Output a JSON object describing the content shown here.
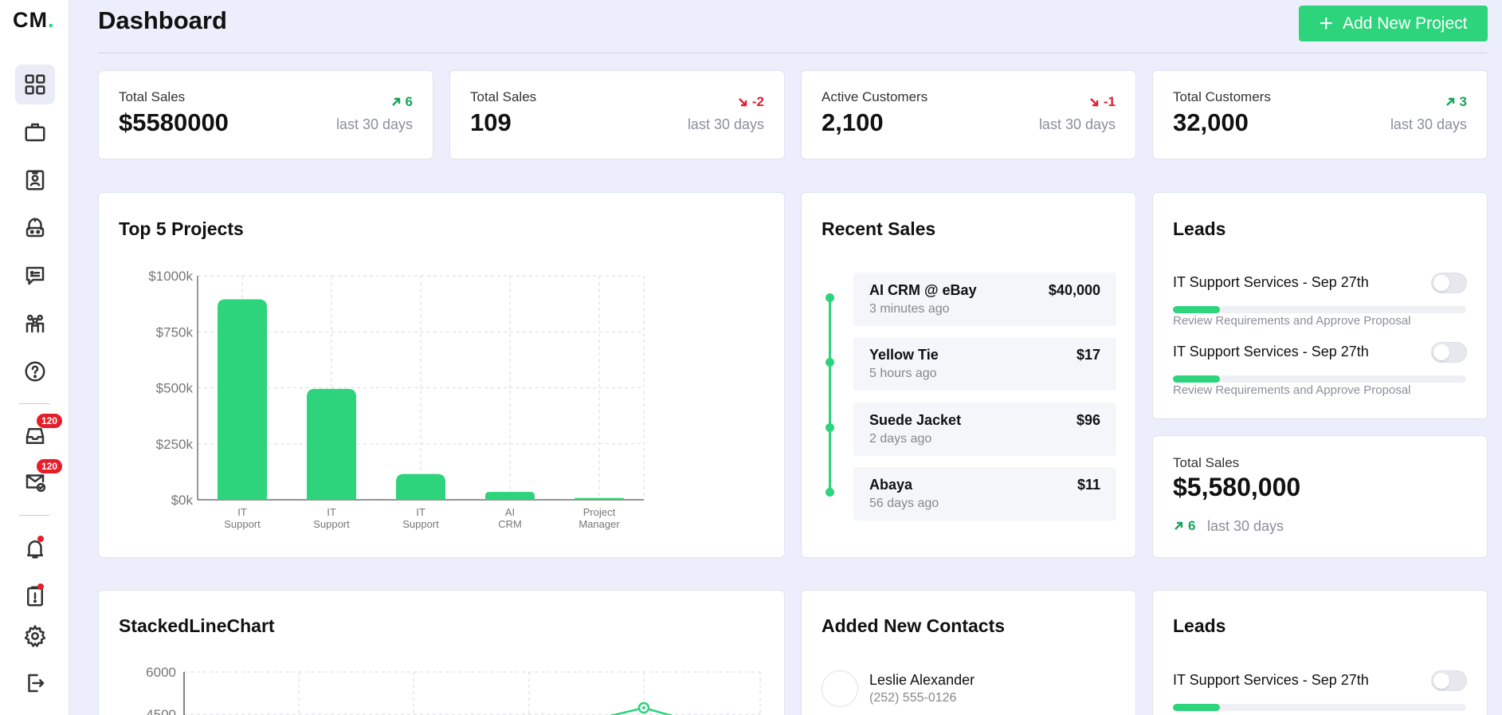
{
  "app": {
    "logo_text": "CM",
    "logo_dot": "."
  },
  "header": {
    "title": "Dashboard",
    "add_button_label": "Add New Project"
  },
  "sidebar": {
    "nav": [
      {
        "icon": "grid-icon",
        "active": true
      },
      {
        "icon": "briefcase-icon"
      },
      {
        "icon": "id-card-icon"
      },
      {
        "icon": "robot-icon"
      },
      {
        "icon": "chat-icon"
      },
      {
        "icon": "team-icon"
      },
      {
        "icon": "help-icon"
      }
    ],
    "inbox_badge": "120",
    "mail_badge": "120"
  },
  "stats": [
    {
      "label": "Total Sales",
      "value": "$5580000",
      "change": "6",
      "direction": "up",
      "period": "last 30 days"
    },
    {
      "label": "Total Sales",
      "value": "109",
      "change": "-2",
      "direction": "down",
      "period": "last 30 days"
    },
    {
      "label": "Active Customers",
      "value": "2,100",
      "change": "-1",
      "direction": "down",
      "period": "last 30 days"
    },
    {
      "label": "Total Customers",
      "value": "32,000",
      "change": "3",
      "direction": "up",
      "period": "last 30 days"
    }
  ],
  "top_projects": {
    "title": "Top 5 Projects"
  },
  "chart_data": [
    {
      "type": "bar",
      "title": "Top 5 Projects",
      "categories": [
        "IT Support",
        "IT Support",
        "IT Support",
        "AI CRM",
        "Project Manager"
      ],
      "category_lines": [
        [
          "IT",
          "Support"
        ],
        [
          "IT",
          "Support"
        ],
        [
          "IT",
          "Support"
        ],
        [
          "AI",
          "CRM"
        ],
        [
          "Project",
          "Manager"
        ]
      ],
      "values": [
        895,
        495,
        115,
        35,
        8
      ],
      "ylim": [
        0,
        1000
      ],
      "yticks": [
        0,
        250,
        500,
        750,
        1000
      ],
      "ytick_labels": [
        "$0k",
        "$250k",
        "$500k",
        "$750k",
        "$1000k"
      ],
      "grid": true,
      "color": "#2dd47b"
    },
    {
      "type": "line",
      "title": "StackedLineChart",
      "yticks_visible": [
        "6000",
        "4500"
      ],
      "ylim": [
        0,
        6000
      ],
      "grid": true,
      "color": "#2dd47b"
    }
  ],
  "recent_sales": {
    "title": "Recent Sales",
    "items": [
      {
        "name": "AI CRM @ eBay",
        "time": "3 minutes ago",
        "amount": "$40,000"
      },
      {
        "name": "Yellow Tie",
        "time": "5 hours ago",
        "amount": "$17"
      },
      {
        "name": "Suede Jacket",
        "time": "2 days ago",
        "amount": "$96"
      },
      {
        "name": "Abaya",
        "time": "56 days ago",
        "amount": "$11"
      }
    ]
  },
  "leads": {
    "title": "Leads",
    "items": [
      {
        "title": "IT Support Services - Sep 27th",
        "subtitle": "Review Requirements and Approve Proposal",
        "progress": 0.16
      },
      {
        "title": "IT Support Services - Sep 27th",
        "subtitle": "Review Requirements and Approve Proposal",
        "progress": 0.16
      }
    ]
  },
  "total_sales_card": {
    "label": "Total Sales",
    "value": "$5,580,000",
    "change": "6",
    "period": "last 30 days"
  },
  "stacked_line": {
    "title": "StackedLineChart"
  },
  "contacts": {
    "title": "Added New Contacts",
    "items": [
      {
        "name": "Leslie Alexander",
        "phone": "(252) 555-0126"
      }
    ]
  },
  "leads2": {
    "title": "Leads",
    "items": [
      {
        "title": "IT Support Services - Sep 27th",
        "progress": 0.16
      }
    ]
  },
  "colors": {
    "accent": "#2dd47b",
    "positive": "#18a35a",
    "negative": "#e51e2b",
    "background": "#eceffb"
  }
}
